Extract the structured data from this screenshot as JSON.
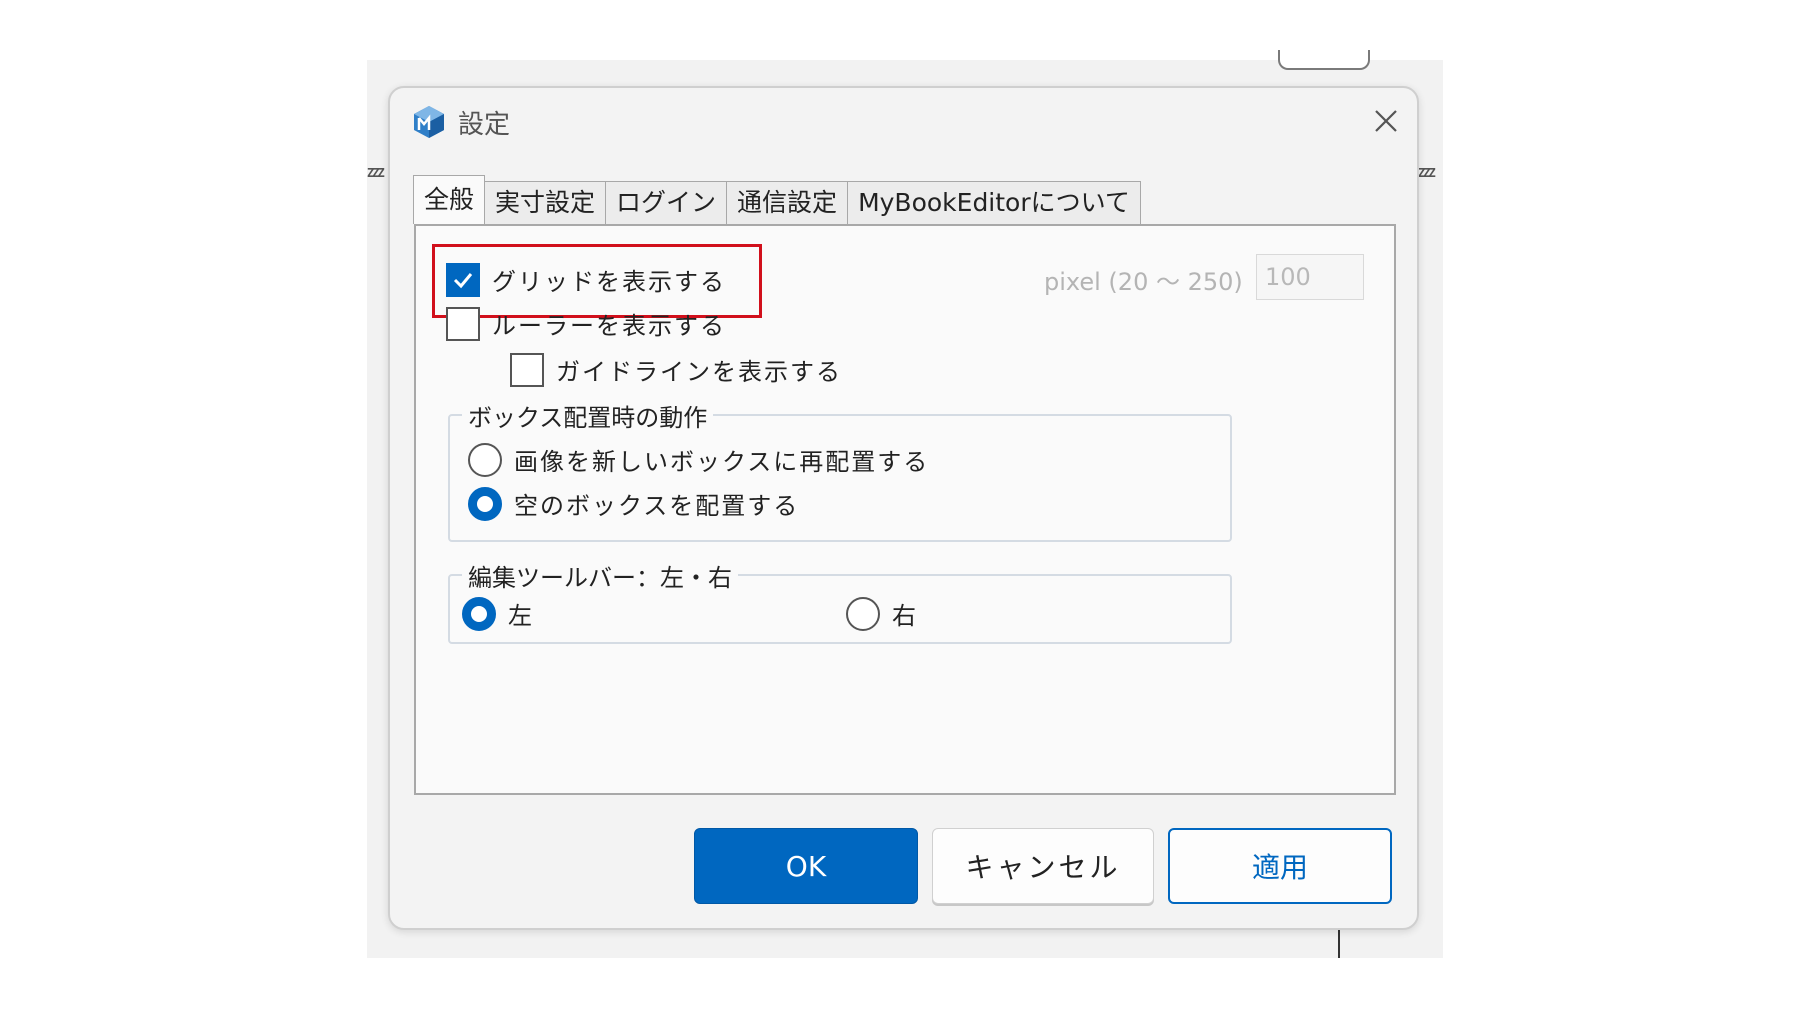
{
  "dialog": {
    "title": "設定",
    "app_icon": "app-logo-icon",
    "close_icon": "close-icon"
  },
  "tabs": [
    {
      "label": "全般",
      "active": true
    },
    {
      "label": "実寸設定",
      "active": false
    },
    {
      "label": "ログイン",
      "active": false
    },
    {
      "label": "通信設定",
      "active": false
    },
    {
      "label": "MyBookEditorについて",
      "active": false
    }
  ],
  "general": {
    "show_grid": {
      "label": "グリッドを表示する",
      "checked": true
    },
    "pixel_range_label": "pixel (20 〜 250)",
    "pixel_value": "100",
    "show_ruler": {
      "label": "ルーラーを表示する",
      "checked": false
    },
    "show_guidelines": {
      "label": "ガイドラインを表示する",
      "checked": false
    },
    "box_placement": {
      "legend": "ボックス配置時の動作",
      "options": [
        {
          "label": "画像を新しいボックスに再配置する",
          "selected": false
        },
        {
          "label": "空のボックスを配置する",
          "selected": true
        }
      ]
    },
    "toolbar_position": {
      "legend": "編集ツールバー：左・右",
      "options": [
        {
          "label": "左",
          "selected": true
        },
        {
          "label": "右",
          "selected": false
        }
      ]
    }
  },
  "buttons": {
    "ok": "OK",
    "cancel": "キャンセル",
    "apply": "適用"
  },
  "colors": {
    "accent": "#0067c0",
    "highlight": "#d10f1b"
  }
}
